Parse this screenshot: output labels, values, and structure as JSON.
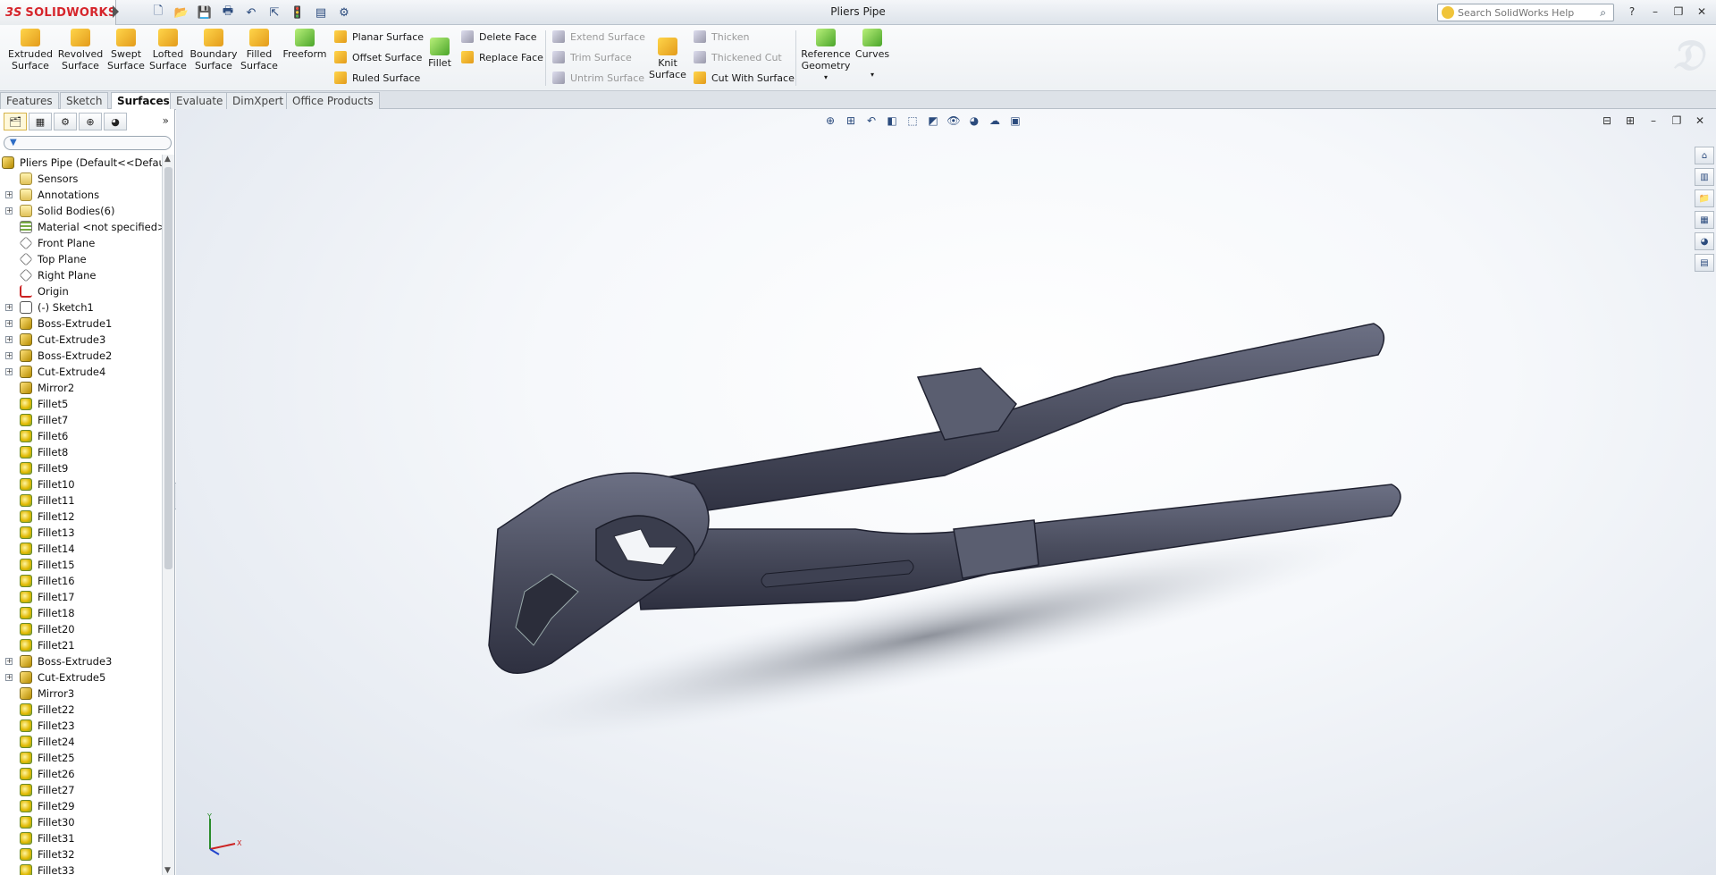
{
  "app": {
    "logo_ds": "3S",
    "logo_name": "SOLIDWORKS",
    "window_title": "Pliers Pipe"
  },
  "help_search": {
    "placeholder": "Search SolidWorks Help"
  },
  "ribbon": {
    "large_buttons": [
      {
        "label": "Extruded\nSurface"
      },
      {
        "label": "Revolved\nSurface"
      },
      {
        "label": "Swept\nSurface"
      },
      {
        "label": "Lofted\nSurface"
      },
      {
        "label": "Boundary\nSurface"
      },
      {
        "label": "Filled\nSurface"
      },
      {
        "label": "Freeform"
      }
    ],
    "planar_surface": "Planar Surface",
    "offset_surface": "Offset Surface",
    "ruled_surface": "Ruled Surface",
    "fillet": "Fillet",
    "delete_face": "Delete Face",
    "replace_face": "Replace Face",
    "extend_surface": "Extend Surface",
    "trim_surface": "Trim Surface",
    "untrim_surface": "Untrim Surface",
    "knit_surface": "Knit\nSurface",
    "thicken": "Thicken",
    "thickened_cut": "Thickened Cut",
    "cut_with_surface": "Cut With Surface",
    "reference_geometry": "Reference\nGeometry",
    "curves": "Curves"
  },
  "tabs": [
    {
      "label": "Features"
    },
    {
      "label": "Sketch"
    },
    {
      "label": "Surfaces",
      "active": true
    },
    {
      "label": "Evaluate"
    },
    {
      "label": "DimXpert"
    },
    {
      "label": "Office Products"
    }
  ],
  "tree": {
    "root": "Pliers Pipe  (Default<<Default",
    "items": [
      {
        "label": "Sensors",
        "icon": "folder",
        "expand": false
      },
      {
        "label": "Annotations",
        "icon": "folder",
        "expand": true
      },
      {
        "label": "Solid Bodies(6)",
        "icon": "folder",
        "expand": true
      },
      {
        "label": "Material <not specified>",
        "icon": "material",
        "expand": false
      },
      {
        "label": "Front Plane",
        "icon": "plane",
        "expand": false
      },
      {
        "label": "Top Plane",
        "icon": "plane",
        "expand": false
      },
      {
        "label": "Right Plane",
        "icon": "plane",
        "expand": false
      },
      {
        "label": "Origin",
        "icon": "origin",
        "expand": false
      },
      {
        "label": "(-) Sketch1",
        "icon": "sketch",
        "expand": true
      },
      {
        "label": "Boss-Extrude1",
        "icon": "feature",
        "expand": true
      },
      {
        "label": "Cut-Extrude3",
        "icon": "feature",
        "expand": true
      },
      {
        "label": "Boss-Extrude2",
        "icon": "feature",
        "expand": true
      },
      {
        "label": "Cut-Extrude4",
        "icon": "feature",
        "expand": true
      },
      {
        "label": "Mirror2",
        "icon": "feature",
        "expand": false
      },
      {
        "label": "Fillet5",
        "icon": "fillet",
        "expand": false
      },
      {
        "label": "Fillet7",
        "icon": "fillet",
        "expand": false
      },
      {
        "label": "Fillet6",
        "icon": "fillet",
        "expand": false
      },
      {
        "label": "Fillet8",
        "icon": "fillet",
        "expand": false
      },
      {
        "label": "Fillet9",
        "icon": "fillet",
        "expand": false
      },
      {
        "label": "Fillet10",
        "icon": "fillet",
        "expand": false
      },
      {
        "label": "Fillet11",
        "icon": "fillet",
        "expand": false
      },
      {
        "label": "Fillet12",
        "icon": "fillet",
        "expand": false
      },
      {
        "label": "Fillet13",
        "icon": "fillet",
        "expand": false
      },
      {
        "label": "Fillet14",
        "icon": "fillet",
        "expand": false
      },
      {
        "label": "Fillet15",
        "icon": "fillet",
        "expand": false
      },
      {
        "label": "Fillet16",
        "icon": "fillet",
        "expand": false
      },
      {
        "label": "Fillet17",
        "icon": "fillet",
        "expand": false
      },
      {
        "label": "Fillet18",
        "icon": "fillet",
        "expand": false
      },
      {
        "label": "Fillet20",
        "icon": "fillet",
        "expand": false
      },
      {
        "label": "Fillet21",
        "icon": "fillet",
        "expand": false
      },
      {
        "label": "Boss-Extrude3",
        "icon": "feature",
        "expand": true
      },
      {
        "label": "Cut-Extrude5",
        "icon": "feature",
        "expand": true
      },
      {
        "label": "Mirror3",
        "icon": "feature",
        "expand": false
      },
      {
        "label": "Fillet22",
        "icon": "fillet",
        "expand": false
      },
      {
        "label": "Fillet23",
        "icon": "fillet",
        "expand": false
      },
      {
        "label": "Fillet24",
        "icon": "fillet",
        "expand": false
      },
      {
        "label": "Fillet25",
        "icon": "fillet",
        "expand": false
      },
      {
        "label": "Fillet26",
        "icon": "fillet",
        "expand": false
      },
      {
        "label": "Fillet27",
        "icon": "fillet",
        "expand": false
      },
      {
        "label": "Fillet29",
        "icon": "fillet",
        "expand": false
      },
      {
        "label": "Fillet30",
        "icon": "fillet",
        "expand": false
      },
      {
        "label": "Fillet31",
        "icon": "fillet",
        "expand": false
      },
      {
        "label": "Fillet32",
        "icon": "fillet",
        "expand": false
      },
      {
        "label": "Fillet33",
        "icon": "fillet",
        "expand": false
      }
    ]
  },
  "triad": {
    "x": "X",
    "y": "Y"
  },
  "colors": {
    "brand": "#d6252b",
    "model": "#4a4d5e"
  }
}
